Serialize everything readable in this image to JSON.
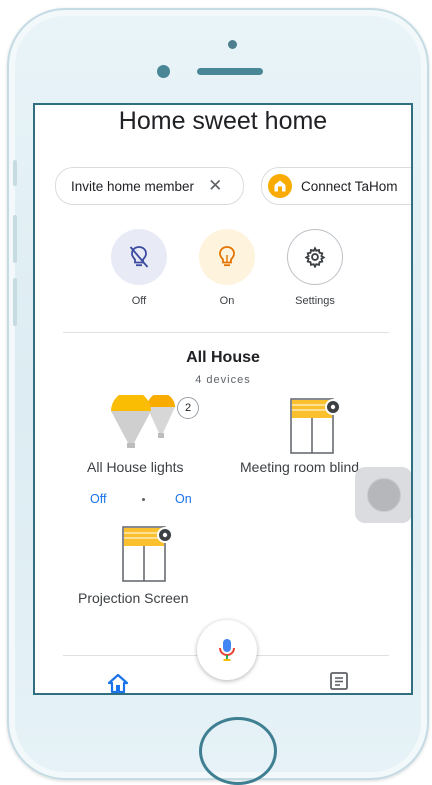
{
  "header": {
    "title": "Home sweet home"
  },
  "chips": {
    "invite_label": "Invite home member",
    "invite_close": "✕",
    "connect_label": "Connect TaHom"
  },
  "quick_actions": [
    {
      "label": "Off",
      "icon": "lightbulb-off-icon"
    },
    {
      "label": "On",
      "icon": "lightbulb-on-icon"
    },
    {
      "label": "Settings",
      "icon": "gear-icon"
    }
  ],
  "room": {
    "title": "All House",
    "device_count": "4 devices",
    "devices": [
      {
        "name": "All House lights",
        "badge": "2",
        "icon": "light-bulbs-group-icon",
        "off_label": "Off",
        "on_label": "On"
      },
      {
        "name": "Meeting room blind",
        "icon": "blind-settings-icon"
      },
      {
        "name": "Projection Screen",
        "icon": "blind-settings-icon"
      }
    ]
  },
  "bottom_nav": {
    "items": [
      {
        "icon": "home-icon"
      },
      {
        "icon": "feed-icon"
      }
    ]
  },
  "colors": {
    "accent_blue": "#1a73e8",
    "bulb_yellow": "#f9ab00",
    "blind_yellow": "#fbc02d",
    "phone_frame": "#3f7f92"
  }
}
